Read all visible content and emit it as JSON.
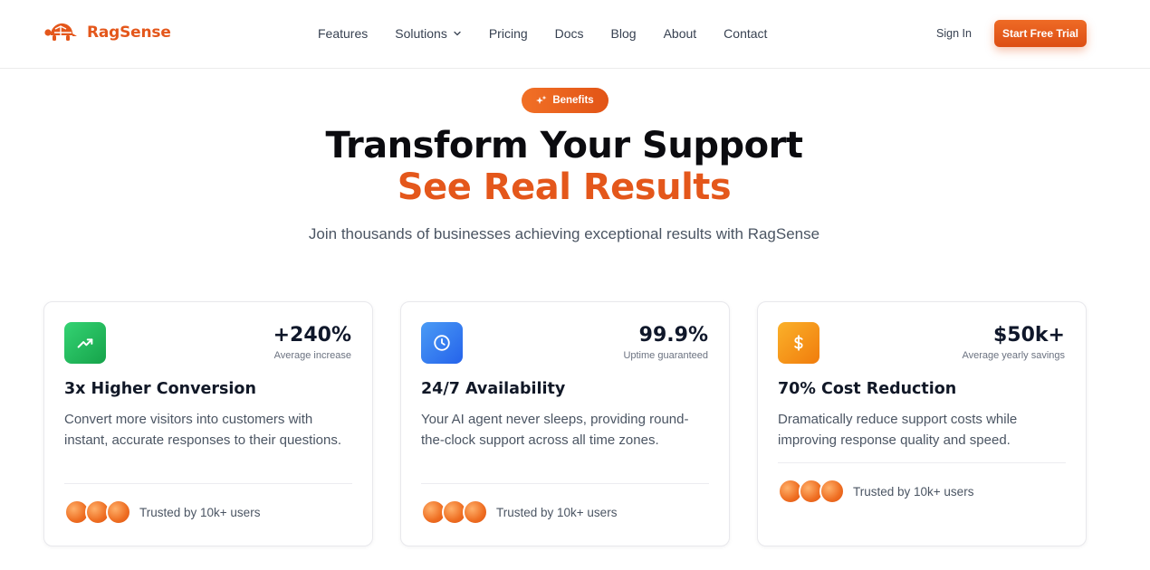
{
  "brand": {
    "name": "RagSense",
    "accent": "#e4571b"
  },
  "nav": {
    "links": [
      "Features",
      "Solutions",
      "Pricing",
      "Docs",
      "Blog",
      "About",
      "Contact"
    ],
    "sign_in": "Sign In",
    "cta": "Start Free Trial"
  },
  "hero": {
    "badge": "Benefits",
    "title_line1": "Transform Your Support",
    "title_line2": "See Real Results",
    "subtitle": "Join thousands of businesses achieving exceptional results with RagSense"
  },
  "cards": [
    {
      "icon": "trending-up-icon",
      "icon_color": "#22c55e",
      "stat_value": "+240%",
      "stat_label": "Average increase",
      "title": "3x Higher Conversion",
      "description": "Convert more visitors into customers with instant, accurate responses to their questions.",
      "trust": "Trusted by 10k+ users"
    },
    {
      "icon": "clock-icon",
      "icon_color": "#3b82f6",
      "stat_value": "99.9%",
      "stat_label": "Uptime guaranteed",
      "title": "24/7 Availability",
      "description": "Your AI agent never sleeps, providing round-the-clock support across all time zones.",
      "trust": "Trusted by 10k+ users"
    },
    {
      "icon": "dollar-icon",
      "icon_color": "#f59e0b",
      "stat_value": "$50k+",
      "stat_label": "Average yearly savings",
      "title": "70% Cost Reduction",
      "description": "Dramatically reduce support costs while improving response quality and speed.",
      "trust": "Trusted by 10k+ users"
    }
  ]
}
